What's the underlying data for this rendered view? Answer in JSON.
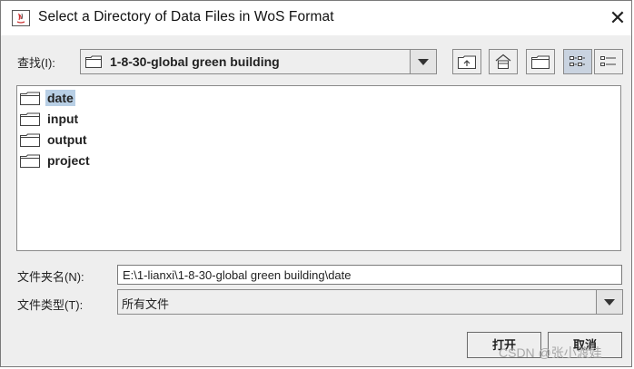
{
  "window": {
    "title": "Select a Directory of Data Files in WoS Format",
    "close_symbol": "✕"
  },
  "look_in": {
    "label": "查找(I):",
    "current_folder": "1-8-30-global green building"
  },
  "toolbar": {
    "buttons": [
      "up-folder-icon",
      "home-icon",
      "new-folder-icon",
      "list-view-icon",
      "details-view-icon"
    ],
    "active_view": "list-view"
  },
  "file_list": {
    "items": [
      {
        "name": "date",
        "selected": true
      },
      {
        "name": "input",
        "selected": false
      },
      {
        "name": "output",
        "selected": false
      },
      {
        "name": "project",
        "selected": false
      }
    ]
  },
  "folder_name": {
    "label": "文件夹名(N):",
    "value": "E:\\1-lianxi\\1-8-30-global green building\\date"
  },
  "file_type": {
    "label": "文件类型(T):",
    "value": "所有文件"
  },
  "buttons": {
    "open": "打开",
    "cancel": "取消"
  },
  "watermark": "CSDN @张小渡娃",
  "colors": {
    "selection": "#b8cfe5",
    "background": "#eeeeee",
    "folder_outline": "#404040"
  }
}
